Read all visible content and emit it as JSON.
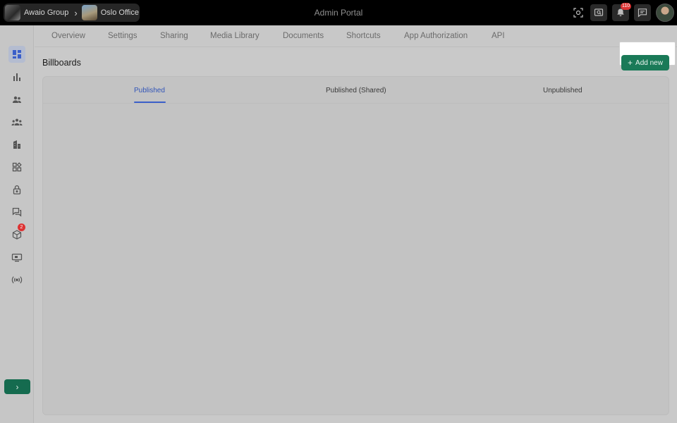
{
  "header": {
    "org_name": "Awaio Group",
    "office_name": "Oslo Office",
    "portal_title": "Admin Portal",
    "notifications_count": "110",
    "icons": [
      "scan-icon",
      "search-screen-icon",
      "bell-icon",
      "chat-icon"
    ]
  },
  "nav_tabs": [
    "Overview",
    "Settings",
    "Sharing",
    "Media Library",
    "Documents",
    "Shortcuts",
    "App Authorization",
    "API"
  ],
  "sidebar": {
    "icons": [
      "dashboard-icon",
      "analytics-icon",
      "users-icon",
      "groups-icon",
      "buildings-icon",
      "apps-icon",
      "lock-icon",
      "messages-icon",
      "packages-icon",
      "billboard-icon",
      "broadcast-icon"
    ],
    "packages_badge": "2",
    "expand_label": "›"
  },
  "page": {
    "title": "Billboards",
    "add_label": "Add new",
    "tabs": [
      "Published",
      "Published (Shared)",
      "Unpublished"
    ],
    "active_tab": "Published"
  },
  "colors": {
    "accent": "#3b5fc9",
    "primary_button": "#1a7a58",
    "topbar": "#000000"
  }
}
